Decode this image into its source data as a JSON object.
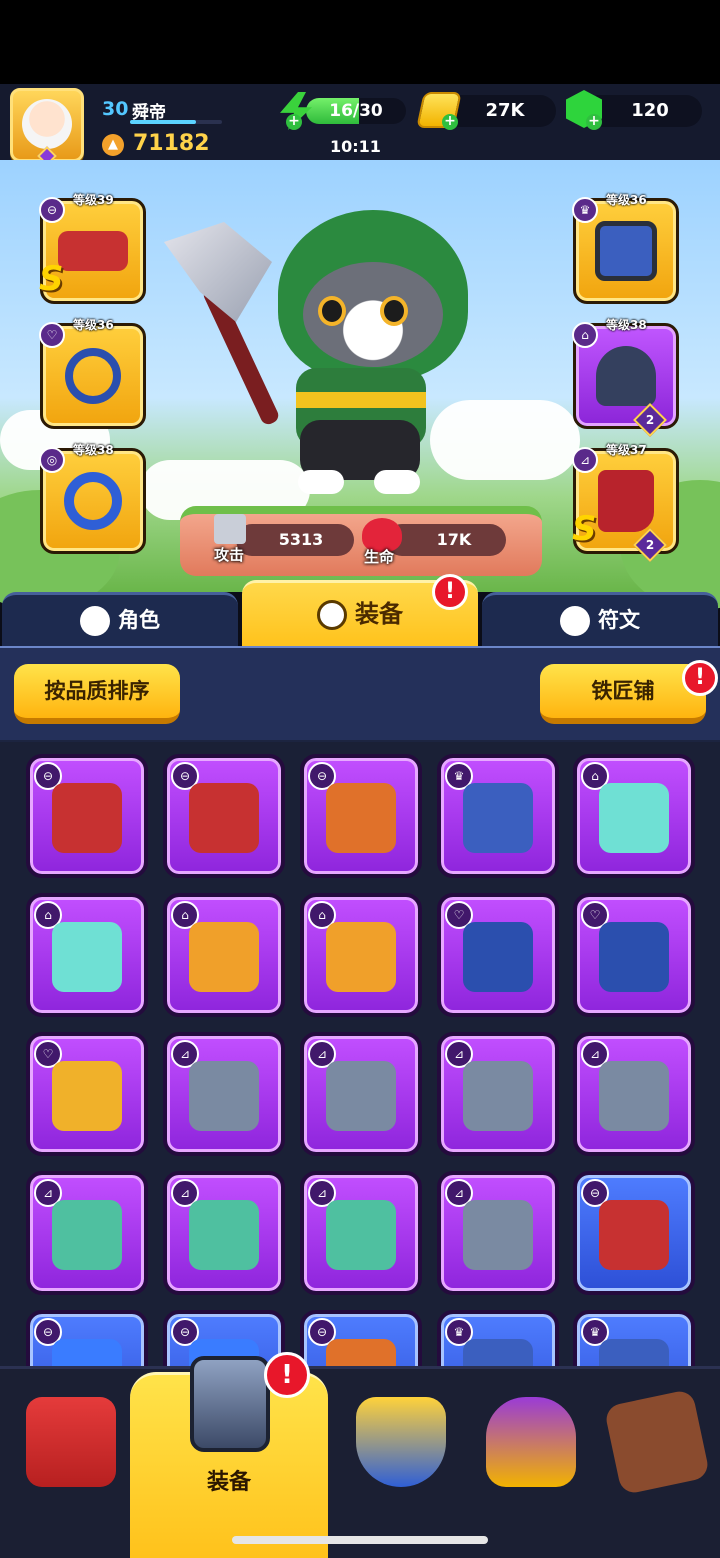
{
  "player": {
    "level": "30",
    "name": "舜帝",
    "xp_fraction": 0.72,
    "power": "71182"
  },
  "resources": {
    "energy": "16/30",
    "energy_fraction": 0.53,
    "energy_timer": "10:11",
    "coins": "27K",
    "gems": "120"
  },
  "equipped": {
    "left": [
      {
        "level": "等级39",
        "type": "bow",
        "grade": "S",
        "rarity": "gold"
      },
      {
        "level": "等级36",
        "type": "amulet",
        "rarity": "gold"
      },
      {
        "level": "等级38",
        "type": "ring",
        "rarity": "gold"
      }
    ],
    "right": [
      {
        "level": "等级36",
        "type": "armor",
        "rarity": "gold"
      },
      {
        "level": "等级38",
        "type": "helmet",
        "stars": "2",
        "rarity": "purple"
      },
      {
        "level": "等级37",
        "type": "boots",
        "grade": "S",
        "stars": "2",
        "rarity": "gold"
      }
    ]
  },
  "stats": {
    "attack_label": "攻击",
    "attack": "5313",
    "hp_label": "生命",
    "hp": "17K"
  },
  "tabs": [
    {
      "label": "角色"
    },
    {
      "label": "装备",
      "badge": "!"
    },
    {
      "label": "符文"
    }
  ],
  "actions": {
    "sort_label": "按品质排序",
    "smith_label": "铁匠铺",
    "smith_badge": "!"
  },
  "inventory": [
    {
      "item": "bow",
      "rarity": "purple"
    },
    {
      "item": "bow",
      "rarity": "purple"
    },
    {
      "item": "weapon",
      "rarity": "purple"
    },
    {
      "item": "armor",
      "rarity": "purple"
    },
    {
      "item": "crown",
      "rarity": "purple"
    },
    {
      "item": "crown",
      "rarity": "purple"
    },
    {
      "item": "helmet",
      "rarity": "purple"
    },
    {
      "item": "helmet",
      "rarity": "purple"
    },
    {
      "item": "amulet",
      "rarity": "purple"
    },
    {
      "item": "amulet",
      "rarity": "purple"
    },
    {
      "item": "bracelet",
      "rarity": "purple"
    },
    {
      "item": "boots",
      "rarity": "purple"
    },
    {
      "item": "boots",
      "rarity": "purple"
    },
    {
      "item": "boots",
      "rarity": "purple"
    },
    {
      "item": "boots",
      "rarity": "purple"
    },
    {
      "item": "shoes",
      "rarity": "purple"
    },
    {
      "item": "shoes",
      "rarity": "purple"
    },
    {
      "item": "shoes",
      "rarity": "purple"
    },
    {
      "item": "boots",
      "rarity": "purple"
    },
    {
      "item": "bow",
      "rarity": "blue"
    },
    {
      "item": "staff",
      "rarity": "blue"
    },
    {
      "item": "staff",
      "rarity": "blue"
    },
    {
      "item": "weapon",
      "rarity": "blue"
    },
    {
      "item": "armor",
      "rarity": "blue"
    },
    {
      "item": "armor",
      "rarity": "blue"
    }
  ],
  "bottom_nav": [
    {
      "name": "shop"
    },
    {
      "name": "equipment",
      "label": "装备",
      "badge": "!"
    },
    {
      "name": "shield"
    },
    {
      "name": "trophy"
    },
    {
      "name": "board"
    }
  ],
  "colors": {
    "gold": "#ffc21b",
    "purple": "#a63cf0",
    "blue": "#3e66ef",
    "panel": "#1c2440"
  }
}
